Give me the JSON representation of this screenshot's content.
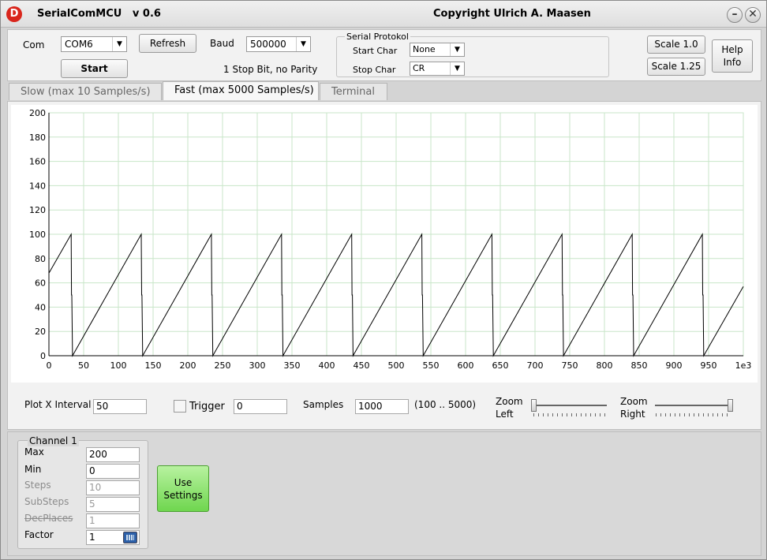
{
  "window": {
    "title": "SerialComMCU   v 0.6",
    "copyright": "Copyright Ulrich A. Maasen",
    "app_icon": "D",
    "minimize": "–",
    "close": "✕"
  },
  "top": {
    "com_label": "Com",
    "com_value": "COM6",
    "refresh_label": "Refresh",
    "start_label": "Start",
    "baud_label": "Baud",
    "baud_value": "500000",
    "stop_info": "1 Stop Bit, no Parity",
    "protokol_title": "Serial Protokol",
    "start_char_label": "Start Char",
    "start_char_value": "None",
    "stop_char_label": "Stop Char",
    "stop_char_value": "CR",
    "scale1_label": "Scale 1.0",
    "scale2_label": "Scale 1.25",
    "help_label": "Help\nInfo"
  },
  "tabs": [
    {
      "label": "Slow   (max 10 Samples/s)",
      "active": false
    },
    {
      "label": "Fast  (max 5000 Samples/s)",
      "active": true
    },
    {
      "label": "Terminal",
      "active": false
    }
  ],
  "chart_data": {
    "type": "line",
    "title": "",
    "xlabel": "",
    "ylabel": "",
    "xlim": [
      0,
      1000
    ],
    "ylim": [
      0,
      200
    ],
    "x_ticks": [
      0,
      50,
      100,
      150,
      200,
      250,
      300,
      350,
      400,
      450,
      500,
      550,
      600,
      650,
      700,
      750,
      800,
      850,
      900,
      950
    ],
    "x_tick_suffix": "1e3",
    "y_ticks": [
      0,
      20,
      40,
      60,
      80,
      100,
      120,
      140,
      160,
      180,
      200
    ],
    "grid": true,
    "grid_color": "#c8e6c8",
    "line_color": "#000000",
    "series": [
      {
        "x": [
          0,
          32,
          32.5,
          33,
          34,
          133,
          133.5,
          134,
          135,
          234,
          234.5,
          235,
          236,
          335,
          335.5,
          336,
          337,
          436,
          436.5,
          437,
          438,
          537,
          537.5,
          538,
          539,
          638,
          638.5,
          639,
          640,
          739,
          739.5,
          740,
          741,
          840,
          840.5,
          841,
          842,
          941,
          941.5,
          942,
          943,
          1000
        ],
        "y": [
          68,
          100,
          50,
          50,
          0,
          100,
          50,
          50,
          0,
          100,
          50,
          50,
          0,
          100,
          50,
          50,
          0,
          100,
          50,
          50,
          0,
          100,
          50,
          50,
          0,
          100,
          50,
          50,
          0,
          100,
          50,
          50,
          0,
          100,
          50,
          50,
          0,
          100,
          50,
          50,
          0,
          57
        ]
      }
    ]
  },
  "controls": {
    "plot_x_interval_label": "Plot X Interval",
    "plot_x_interval_value": "50",
    "trigger_label": "Trigger",
    "trigger_value": "0",
    "samples_label": "Samples",
    "samples_value": "1000",
    "samples_range": "(100 .. 5000)",
    "zoom_left_label": "Zoom\nLeft",
    "zoom_right_label": "Zoom\nRight",
    "zoom_left_level": 0,
    "zoom_right_level": 1
  },
  "channel": {
    "title": "Channel 1",
    "max_label": "Max",
    "max_value": "200",
    "min_label": "Min",
    "min_value": "0",
    "steps_label": "Steps",
    "steps_value": "10",
    "substeps_label": "SubSteps",
    "substeps_value": "5",
    "decplaces_label": "DecPlaces",
    "decplaces_value": "1",
    "factor_label": "Factor",
    "factor_value": "1",
    "calc_icon": "calculator-icon"
  },
  "use_settings_label": "Use\nSettings"
}
